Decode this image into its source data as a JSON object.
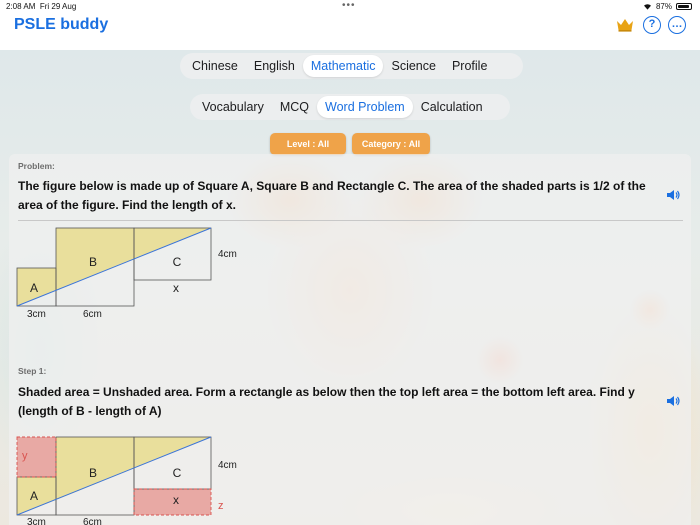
{
  "status": {
    "time": "2:08 AM",
    "date": "Fri 29 Aug",
    "battery": "87%"
  },
  "app": {
    "title": "PSLE buddy"
  },
  "subject_tabs": [
    "Chinese",
    "English",
    "Mathematic",
    "Science",
    "Profile"
  ],
  "subject_active_index": 2,
  "type_tabs": [
    "Vocabulary",
    "MCQ",
    "Word Problem",
    "Calculation"
  ],
  "type_active_index": 2,
  "filters": {
    "level": "Level : All",
    "category": "Category : All"
  },
  "problem": {
    "label": "Problem:",
    "text": "The figure below is made up of Square A, Square B and Rectangle C. The area of the shaded parts is 1/2 of the area of the figure. Find the length of x."
  },
  "figure1": {
    "a": "A",
    "b": "B",
    "c": "C",
    "x": "x",
    "dim_4cm": "4cm",
    "dim_3cm": "3cm",
    "dim_6cm": "6cm"
  },
  "step1": {
    "label": "Step 1:",
    "text": "Shaded area = Unshaded area. Form a rectangle as below then the top left area = the bottom left area. Find y (length of B - length of A)"
  },
  "figure2": {
    "a": "A",
    "b": "B",
    "c": "C",
    "x": "x",
    "y": "y",
    "z": "z",
    "dim_4cm": "4cm",
    "dim_3cm": "3cm",
    "dim_6cm": "6cm"
  },
  "colors": {
    "accent": "#1a6fe0",
    "filter": "#efa349",
    "shade": "#e9df9c",
    "red_shade": "#e8a9a4"
  }
}
